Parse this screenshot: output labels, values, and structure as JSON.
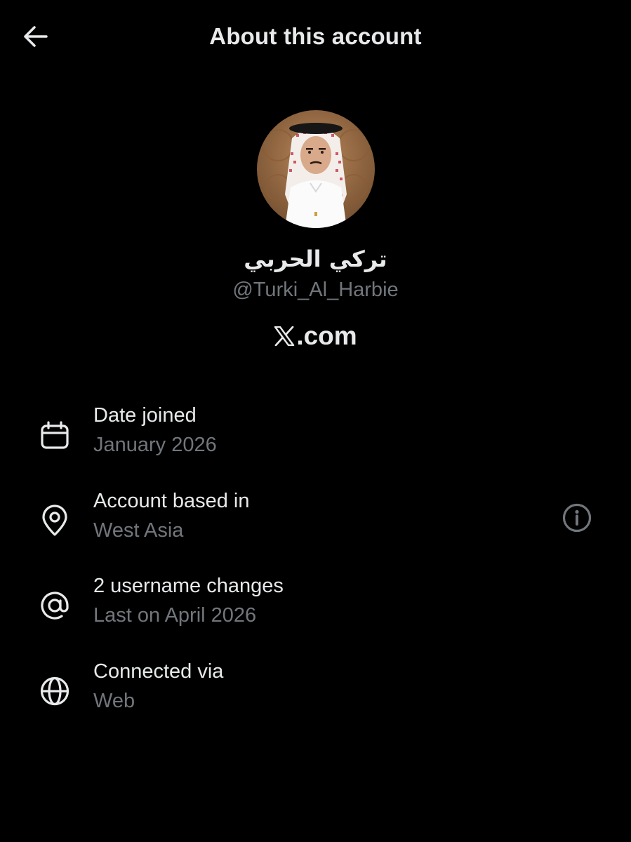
{
  "header": {
    "title": "About this account",
    "back_icon": "arrow-left-icon"
  },
  "profile": {
    "display_name": "تركي الحربي",
    "handle": "@Turki_Al_Harbie",
    "platform_logo": "x-logo-icon",
    "platform_text": ".com"
  },
  "details": [
    {
      "icon": "calendar-icon",
      "label": "Date joined",
      "value": "January 2026"
    },
    {
      "icon": "location-pin-icon",
      "label": "Account based in",
      "value": "West Asia",
      "action_icon": "info-icon"
    },
    {
      "icon": "at-sign-icon",
      "label": "2 username changes",
      "value": "Last on April 2026"
    },
    {
      "icon": "globe-icon",
      "label": "Connected via",
      "value": "Web"
    }
  ],
  "colors": {
    "background": "#000000",
    "primary_text": "#e7e9ea",
    "secondary_text": "#71767b"
  }
}
